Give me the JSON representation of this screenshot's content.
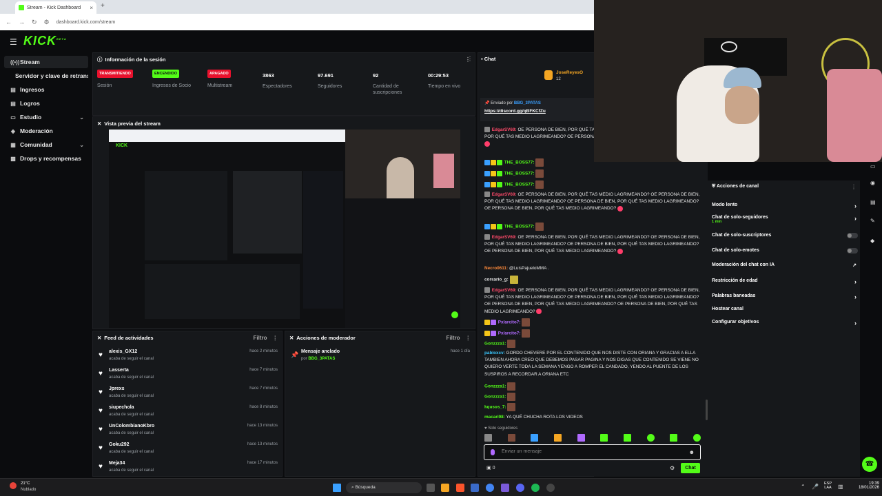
{
  "browser": {
    "tab_title": "Stream - Kick Dashboard",
    "tab_close": "×",
    "new_tab": "+",
    "url": "dashboard.kick.com/stream"
  },
  "app": {
    "logo": "KICK",
    "logo_superscript": "BETA"
  },
  "sidebar": {
    "items": [
      {
        "label": "Stream",
        "icon": "stream-icon",
        "active": true
      },
      {
        "label": "Servidor y clave de retransmisión",
        "icon": "",
        "active": false
      },
      {
        "label": "Ingresos",
        "icon": "income-icon",
        "active": false
      },
      {
        "label": "Logros",
        "icon": "achievements-icon",
        "active": false
      },
      {
        "label": "Estudio",
        "icon": "studio-icon",
        "active": false,
        "expandable": true
      },
      {
        "label": "Moderación",
        "icon": "moderation-icon",
        "active": false
      },
      {
        "label": "Comunidad",
        "icon": "community-icon",
        "active": false,
        "expandable": true
      },
      {
        "label": "Drops y recompensas",
        "icon": "drops-icon",
        "active": false
      }
    ]
  },
  "session": {
    "title": "Información de la sesión",
    "stats": [
      {
        "badge": "TRANSMITIENDO",
        "badge_color": "#e8112d",
        "label": "Sesión"
      },
      {
        "badge": "ENCENDIDO",
        "badge_color": "#53fc18",
        "label": "Ingresos de Socio"
      },
      {
        "badge": "APAGADO",
        "badge_color": "#e8112d",
        "label": "Multistream"
      },
      {
        "value": "3863",
        "label": "Espectadores"
      },
      {
        "value": "97.691",
        "label": "Seguidores"
      },
      {
        "value": "92",
        "label": "Cantidad de suscripciones"
      },
      {
        "value": "00:29:53",
        "label": "Tiempo en vivo"
      }
    ]
  },
  "preview": {
    "title": "Vista previa del stream"
  },
  "activity": {
    "title": "Feed de actividades",
    "filter": "Filtro",
    "items": [
      {
        "name": "alexis_GX12",
        "sub": "acaba de seguir el canal",
        "time": "hace 2 minutos"
      },
      {
        "name": "Lasserta",
        "sub": "acaba de seguir el canal",
        "time": "hace 7 minutos"
      },
      {
        "name": "Jprexs",
        "sub": "acaba de seguir el canal",
        "time": "hace 7 minutos"
      },
      {
        "name": "siupechola",
        "sub": "acaba de seguir el canal",
        "time": "hace 8 minutos"
      },
      {
        "name": "UnColombianoKbro",
        "sub": "acaba de seguir el canal",
        "time": "hace 13 minutos"
      },
      {
        "name": "Goku292",
        "sub": "acaba de seguir el canal",
        "time": "hace 13 minutos"
      },
      {
        "name": "Meja34",
        "sub": "acaba de seguir el canal",
        "time": "hace 17 minutos"
      }
    ]
  },
  "mod_actions": {
    "title": "Acciones de moderador",
    "filter": "Filtro",
    "items": [
      {
        "title": "Mensaje anclado",
        "by_prefix": "por",
        "by": "BBG_3PATAS",
        "time": "hace 1 día"
      }
    ]
  },
  "chat": {
    "title": "Chat",
    "top_user": "JoseReyesO",
    "top_user_count": "12",
    "pinned_prefix": "Enviado por",
    "pinned_user": "BBG_3PATAS",
    "pinned_link": "https://discord.gg/qBFKCfZu",
    "messages": [
      {
        "user": "EdgarSV69:",
        "color": "#ff4a6a",
        "text": "OE PERSONA DE BIEN, POR QUÉ TAS MEDIO LAGRIMEANDO? OE PERSONA DE BIEN, POR QUÉ TAS MEDIO LAGRIMEANDO? OE PERSONA DE BIEN, POR QUÉ TAS MEDIO LAGRIMEANDO?"
      },
      {
        "user": "THE_BOSS77:",
        "color": "#53fc18",
        "text": ""
      },
      {
        "user": "THE_BOSS77:",
        "color": "#53fc18",
        "text": ""
      },
      {
        "user": "THE_BOSS77:",
        "color": "#53fc18",
        "text": ""
      },
      {
        "user": "EdgarSV69:",
        "color": "#ff4a6a",
        "text": "OE PERSONA DE BIEN, POR QUÉ TAS MEDIO LAGRIMEANDO? OE PERSONA DE BIEN, POR QUÉ TAS MEDIO LAGRIMEANDO? OE PERSONA DE BIEN, POR QUÉ TAS MEDIO LAGRIMEANDO? OE PERSONA DE BIEN, POR QUÉ TAS MEDIO LAGRIMEANDO?"
      },
      {
        "user": "THE_BOSS77:",
        "color": "#53fc18",
        "text": ""
      },
      {
        "user": "EdgarSV69:",
        "color": "#ff4a6a",
        "text": "OE PERSONA DE BIEN, POR QUÉ TAS MEDIO LAGRIMEANDO? OE PERSONA DE BIEN, POR QUÉ TAS MEDIO LAGRIMEANDO? OE PERSONA DE BIEN, POR QUÉ TAS MEDIO LAGRIMEANDO? OE PERSONA DE BIEN, POR QUÉ TAS MEDIO LAGRIMEANDO?"
      },
      {
        "user": "Necro0611:",
        "color": "#ff8a3a",
        "text": "@LuisPajueloMMA ."
      },
      {
        "user": "corsario_g:",
        "color": "#e8e8e8",
        "text": ""
      },
      {
        "user": "EdgarSV69:",
        "color": "#ff4a6a",
        "text": "OE PERSONA DE BIEN, POR QUÉ TAS MEDIO LAGRIMEANDO? OE PERSONA DE BIEN, POR QUÉ TAS MEDIO LAGRIMEANDO? OE PERSONA DE BIEN, POR QUÉ TAS MEDIO LAGRIMEANDO? OE PERSONA DE BIEN, POR QUÉ TAS MEDIO LAGRIMEANDO? OE PERSONA DE BIEN, POR QUÉ TAS MEDIO LAGRIMEANDO?"
      },
      {
        "user": "Pxlarcito7:",
        "color": "#b06aff",
        "text": ""
      },
      {
        "user": "Pxlarcito7:",
        "color": "#b06aff",
        "text": ""
      },
      {
        "user": "Gonzzza1:",
        "color": "#53fc18",
        "text": ""
      },
      {
        "user": "pabloxcv:",
        "color": "#3ac8ff",
        "text": "GORDO CHEVERE POR EL CONTENIDO QUE NOS DISTE CON ORIANA Y GRACIAS A ELLA TAMBIEN AHORA CREO QUE DEBEMOS PASAR PAGINA Y NOS DIGAS QUE CONTENIDO SE VIENE NO QUIERO VERTE TODA LA SEMANA YENGO A ROMPER EL CANDADO, YENDO AL PUENTE DE LOS SUSPIROS A RECORDAR A ORIANA ETC"
      },
      {
        "user": "Gonzzza1:",
        "color": "#53fc18",
        "text": ""
      },
      {
        "user": "Gonzzza1:",
        "color": "#53fc18",
        "text": ""
      },
      {
        "user": "kqusos_7:",
        "color": "#53fc18",
        "text": ""
      },
      {
        "user": "macari98:",
        "color": "#53fc18",
        "text": "YA QUÉ CHUCHA ROTA LOS VIDEOS"
      }
    ],
    "followers_only": "Solo seguidores",
    "input_placeholder": "Enviar un mensaje",
    "points": "0",
    "send": "Chat"
  },
  "channel_actions": {
    "title": "Acciones de canal",
    "items": [
      {
        "label": "Modo lento",
        "control": "chevron"
      },
      {
        "label": "Chat de solo-seguidores",
        "sub": "1 min",
        "control": "chevron"
      },
      {
        "label": "Chat de solo-suscriptores",
        "control": "toggle"
      },
      {
        "label": "Chat de solo-emotes",
        "control": "toggle"
      },
      {
        "label": "Moderación del chat con IA",
        "control": "external"
      },
      {
        "label": "Restricción de edad",
        "control": "chevron"
      },
      {
        "label": "Palabras baneadas",
        "control": "chevron"
      },
      {
        "label": "Hostear canal",
        "control": "none"
      },
      {
        "label": "Configurar objetivos",
        "control": "chevron"
      }
    ]
  },
  "taskbar": {
    "weather_temp": "21°C",
    "weather_desc": "Nublado",
    "search": "Búsqueda",
    "lang": "ESP",
    "lang2": "LAA",
    "time": "19:39",
    "date": "18/01/2026"
  },
  "colors": {
    "brand": "#53fc18",
    "live": "#e8112d"
  }
}
